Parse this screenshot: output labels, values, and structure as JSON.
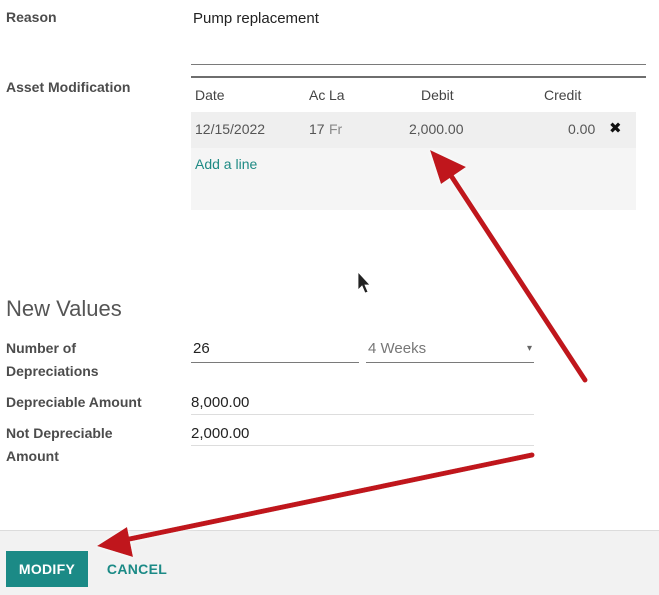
{
  "reason": {
    "label": "Reason",
    "value": "Pump replacement"
  },
  "asset_modification": {
    "label": "Asset Modification",
    "columns": {
      "date": "Date",
      "account": "Ac",
      "label": "La",
      "debit": "Debit",
      "credit": "Credit"
    },
    "rows": [
      {
        "date": "12/15/2022",
        "account": "17",
        "label": "Fr",
        "debit": "2,000.00",
        "credit": "0.00"
      }
    ],
    "add_line": "Add a line"
  },
  "new_values": {
    "title": "New Values",
    "num_depreciations": {
      "label_line1": "Number of",
      "label_line2": "Depreciations",
      "value": "26",
      "period": "4 Weeks"
    },
    "depreciable_amount": {
      "label": "Depreciable Amount",
      "value": "8,000.00"
    },
    "not_depreciable_amount": {
      "label_line1": "Not Depreciable",
      "label_line2": "Amount",
      "value": "2,000.00"
    }
  },
  "footer": {
    "modify_label": "MODIFY",
    "cancel_label": "CANCEL"
  },
  "colors": {
    "accent": "#1b8a86",
    "annotation_arrow": "#c0171b"
  },
  "icons": {
    "remove_line": "close-icon",
    "cursor": "mouse-pointer-icon",
    "dropdown": "chevron-down-icon"
  }
}
